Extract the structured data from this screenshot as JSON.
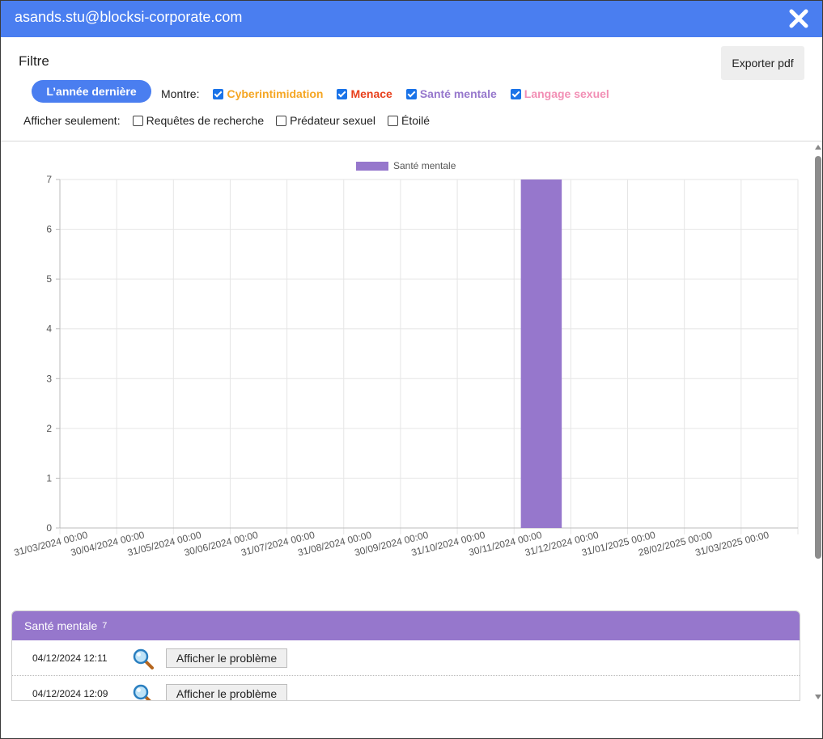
{
  "titlebar": {
    "title": "asands.stu@blocksi-corporate.com"
  },
  "filter": {
    "label": "Filtre",
    "export_label": "Exporter pdf",
    "period_label": "L’année dernière",
    "show_label": "Montre:",
    "categories": [
      {
        "label": "Cyberintimidation",
        "color": "#f5a623",
        "checked": true
      },
      {
        "label": "Menace",
        "color": "#e8401c",
        "checked": true
      },
      {
        "label": "Santé mentale",
        "color": "#9677cc",
        "checked": true
      },
      {
        "label": "Langage sexuel",
        "color": "#f28fb5",
        "checked": true
      }
    ],
    "only_label": "Afficher seulement:",
    "only_options": [
      {
        "label": "Requêtes de recherche",
        "checked": false
      },
      {
        "label": "Prédateur sexuel",
        "checked": false
      },
      {
        "label": "Étoilé",
        "checked": false
      }
    ]
  },
  "chart_data": {
    "type": "bar",
    "categories": [
      "31/03/2024 00:00",
      "30/04/2024 00:00",
      "31/05/2024 00:00",
      "30/06/2024 00:00",
      "31/07/2024 00:00",
      "31/08/2024 00:00",
      "30/09/2024 00:00",
      "31/10/2024 00:00",
      "30/11/2024 00:00",
      "31/12/2024 00:00",
      "31/01/2025 00:00",
      "28/02/2025 00:00",
      "31/03/2025 00:00"
    ],
    "series": [
      {
        "name": "Santé mentale",
        "color": "#9677cc",
        "values": [
          0,
          0,
          0,
          0,
          0,
          0,
          0,
          0,
          7,
          0,
          0,
          0,
          0
        ]
      }
    ],
    "ylim": [
      0,
      7
    ],
    "yticks": [
      0,
      1,
      2,
      3,
      4,
      5,
      6,
      7
    ],
    "grid": true,
    "legend": "top-center"
  },
  "panel": {
    "title": "Santé mentale",
    "count": "7",
    "rows": [
      {
        "date": "04/12/2024 12:11",
        "button": "Afficher le problème"
      },
      {
        "date": "04/12/2024 12:09",
        "button": "Afficher le problème"
      }
    ]
  }
}
